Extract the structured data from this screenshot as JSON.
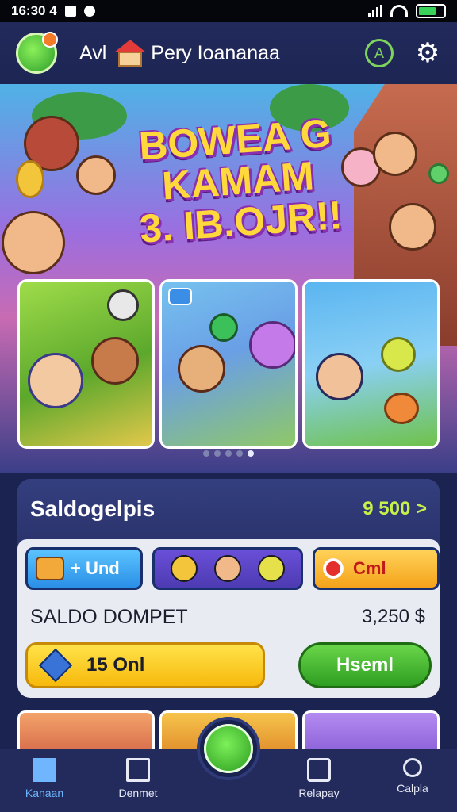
{
  "status_bar": {
    "time": "16:30 4",
    "battery_level": 0.7
  },
  "header": {
    "title_a": "Avl",
    "title_b": "Pery Ioananaa",
    "icons": [
      "app-logo",
      "house-icon",
      "compass-icon",
      "settings-icon"
    ]
  },
  "banner": {
    "headline_line1": "BOWEA G",
    "headline_line2": "KAMAM",
    "headline_line3": "3. IB.OJR!!",
    "carousel_pages": 5,
    "carousel_active": 4
  },
  "wallet": {
    "title": "Saldogelpis",
    "balance": "9 500 >",
    "chip_add_label": "+ Und",
    "chip_cash_label": "Cml",
    "dompet_label": "SALDO DOMPET",
    "dompet_value": "3,250 $",
    "gold_button_label": "15 Onl",
    "green_button_label": "Hseml"
  },
  "nav": {
    "items": [
      {
        "label": "Kanaan",
        "icon": "home-icon"
      },
      {
        "label": "Denmet",
        "icon": "bank-icon"
      },
      {
        "label": "Relapay",
        "icon": "card-icon"
      },
      {
        "label": "Calpla",
        "icon": "search-icon"
      }
    ],
    "center_icon": "play-icon"
  },
  "colors": {
    "accent_green": "#7ed35d",
    "balance_color": "#c8f04a",
    "nav_active": "#6fb6ff",
    "background": "#1b2350"
  }
}
